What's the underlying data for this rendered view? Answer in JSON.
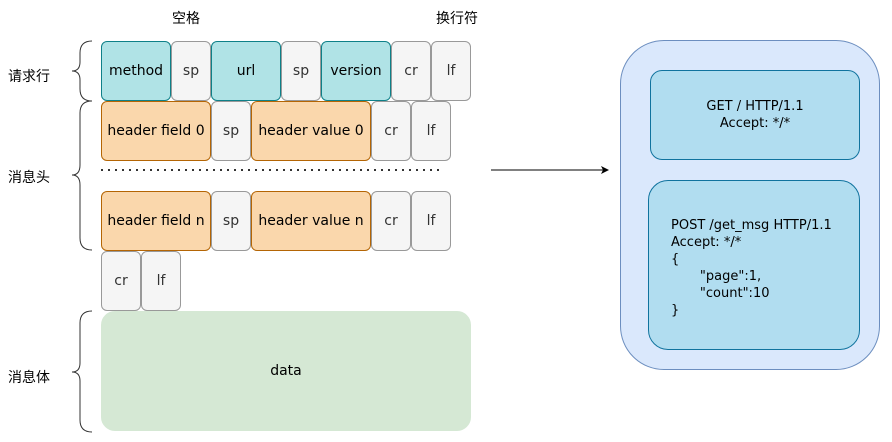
{
  "top_labels": {
    "space": "空格",
    "newline": "换行符"
  },
  "side_labels": {
    "request_line": "请求行",
    "headers": "消息头",
    "body": "消息体"
  },
  "request_line": {
    "method": "method",
    "sp1": "sp",
    "url": "url",
    "sp2": "sp",
    "version": "version",
    "cr": "cr",
    "lf": "lf"
  },
  "header0": {
    "field": "header field 0",
    "sp": "sp",
    "value": "header value 0",
    "cr": "cr",
    "lf": "lf"
  },
  "headern": {
    "field": "header field n",
    "sp": "sp",
    "value": "header value n",
    "cr": "cr",
    "lf": "lf"
  },
  "blank_line": {
    "cr": "cr",
    "lf": "lf"
  },
  "body": {
    "label": "data"
  },
  "examples": {
    "get": "GET / HTTP/1.1\nAccept: */*",
    "post": "POST /get_msg HTTP/1.1\nAccept: */*\n{\n       \"page\":1,\n       \"count\":10\n}"
  },
  "colors": {
    "teal": "#b0e3e6",
    "orange": "#fad7ac",
    "gray": "#f5f5f5",
    "green": "#d5e8d4",
    "outer_box": "#dae8fc",
    "inner_box": "#b1ddf0"
  }
}
